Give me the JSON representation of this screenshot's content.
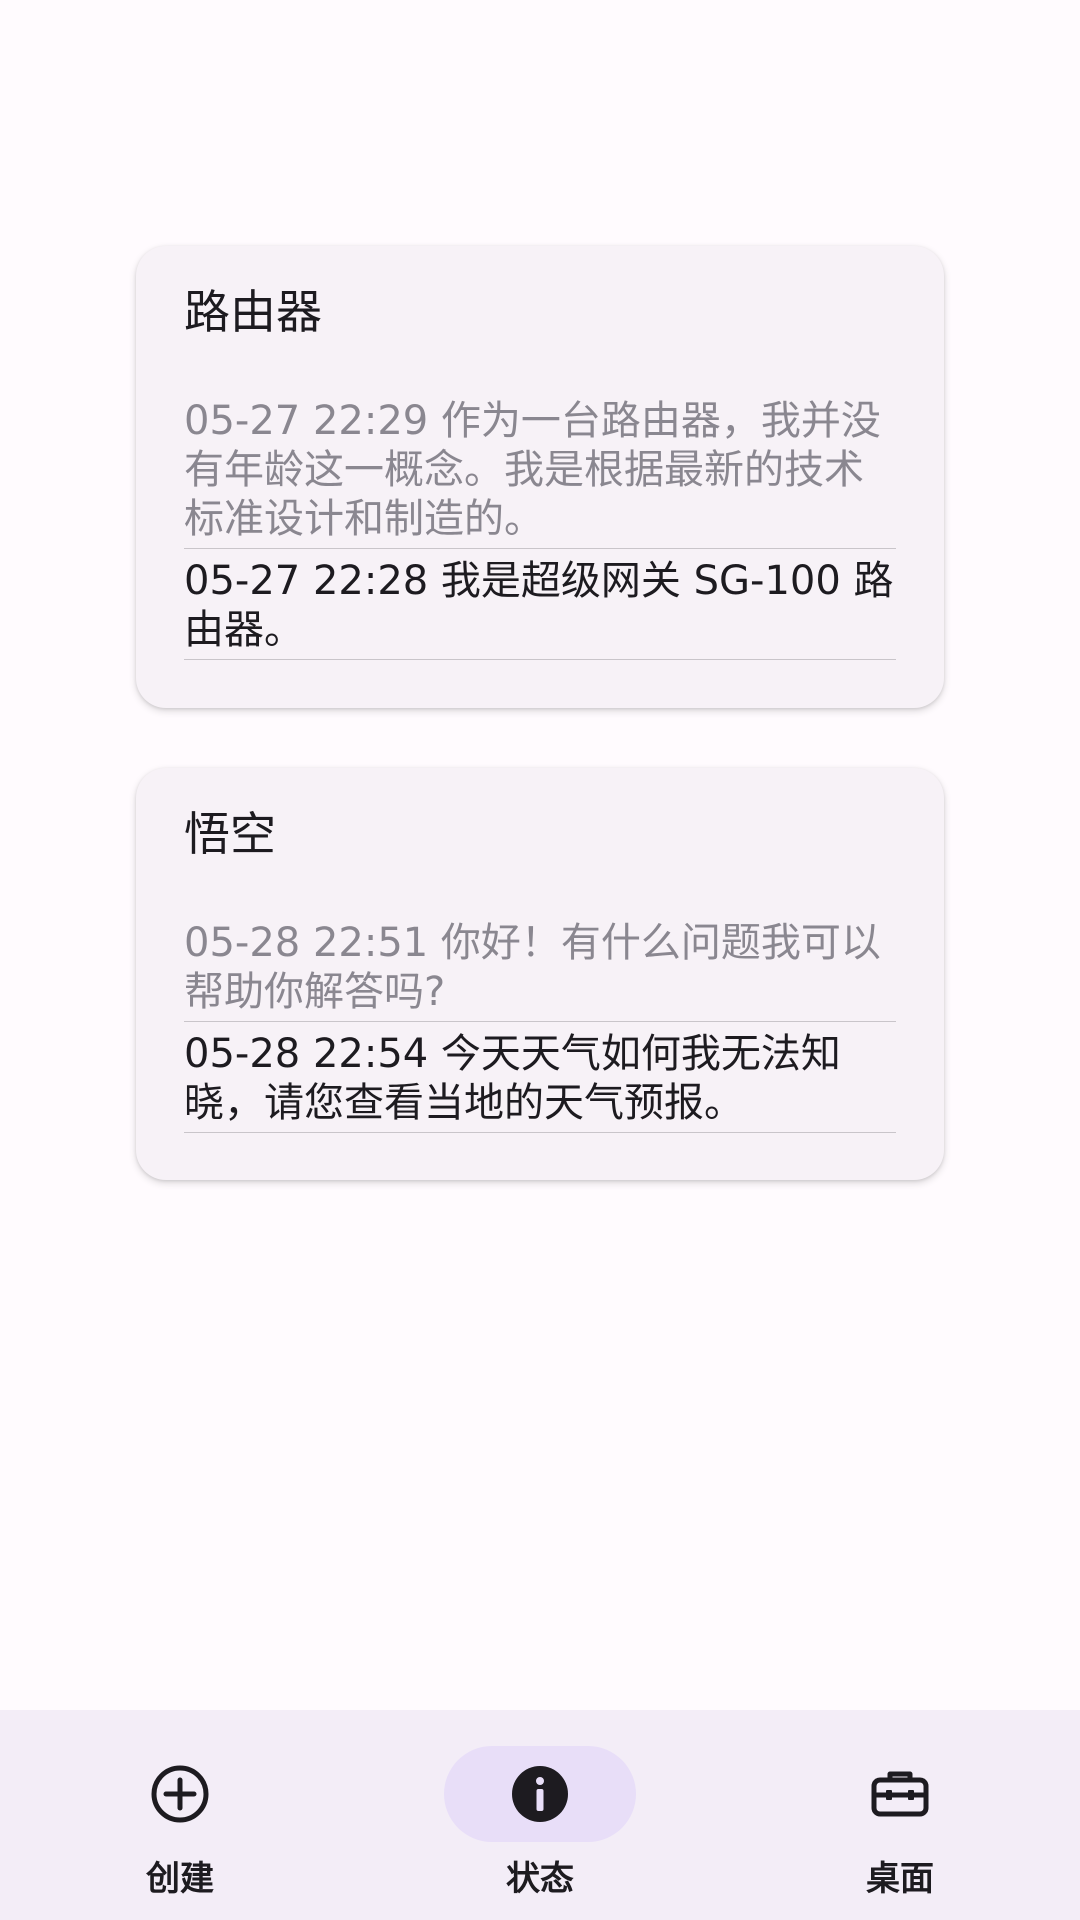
{
  "cards": [
    {
      "title": "路由器",
      "messages": [
        {
          "text": "05-27 22:29 作为一台路由器，我并没有年龄这一概念。我是根据最新的技术标准设计和制造的。"
        },
        {
          "text": "05-27 22:28 我是超级网关 SG-100 路由器。"
        }
      ]
    },
    {
      "title": "悟空",
      "messages": [
        {
          "text": "05-28 22:51 你好！有什么问题我可以帮助你解答吗?"
        },
        {
          "text": "05-28 22:54 今天天气如何我无法知晓，请您查看当地的天气预报。"
        }
      ]
    }
  ],
  "nav": {
    "create": {
      "label": "创建",
      "icon": "add-circle-icon"
    },
    "status": {
      "label": "状态",
      "icon": "info-icon",
      "selected": true
    },
    "desktop": {
      "label": "桌面",
      "icon": "toolbox-icon"
    }
  },
  "colors": {
    "background": "#fffbfe",
    "card": "#f7f2f7",
    "nav_bar": "#f3edf7",
    "selected_pill": "#e8def8",
    "primary_text": "#1d1b20",
    "secondary_text": "#8a8790"
  }
}
